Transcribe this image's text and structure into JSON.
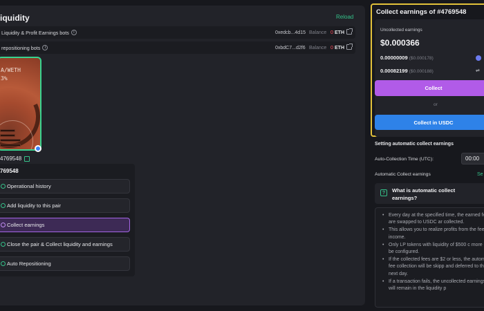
{
  "left": {
    "title": "iquidity",
    "reload": "Reload",
    "bots": [
      {
        "label": "Liquidity & Profit Earnings bots",
        "address": "0xedcb...4d15",
        "balance_label": "Balance",
        "balance": "0",
        "unit": "ETH"
      },
      {
        "label": "repositioning bots",
        "address": "0xbdC7...d2f6",
        "balance_label": "Balance",
        "balance": "0",
        "unit": "ETH"
      }
    ],
    "nft": {
      "line1": "A/WETH",
      "line2": "3%"
    },
    "token_id": "4769548",
    "menu": {
      "title": "769548",
      "items": [
        {
          "label": "Operational history"
        },
        {
          "label": "Add liquidity to this pair"
        },
        {
          "label": "Collect earnings"
        },
        {
          "label": "Close the pair & Collect liquidity and earnings"
        },
        {
          "label": "Auto Repositioning"
        }
      ]
    }
  },
  "collect": {
    "title": "Collect earnings of #4769548",
    "uncollected_label": "Uncollected earnings",
    "uncollected_value": "$0.000366",
    "token1_amount": "0.00000009",
    "token1_usd": "($0.000178)",
    "token2_amount": "0.00082199",
    "token2_usd": "($0.000188)",
    "collect_btn": "Collect",
    "or": "or",
    "usdc_btn": "Collect in USDC"
  },
  "auto": {
    "title": "Setting automatic collect earnings",
    "time_label": "Auto-Collection Time (UTC):",
    "time_value": "00:00",
    "earn_label": "Automatic Collect earnings",
    "earn_link": "Se",
    "faq_q": "What is automatic collect earnings?",
    "faq_icon": "?",
    "answers": [
      "Every day at the specified time, the earned fees are swapped to USDC ar collected.",
      "This allows you to realize profits from the fee income.",
      "Only LP tokens with liquidity of $500 c more can be configured.",
      "If the collected fees are $2 or less, the automatic fee collection will be skipp and deferred to the next day.",
      "If a transaction fails, the uncollected earnings will remain in the liquidity p"
    ]
  },
  "colors": {
    "accent_green": "#35c28a",
    "purple": "#b15be8",
    "blue": "#2e82e8",
    "gold": "#e3c23a",
    "red": "#ff4a5a"
  }
}
